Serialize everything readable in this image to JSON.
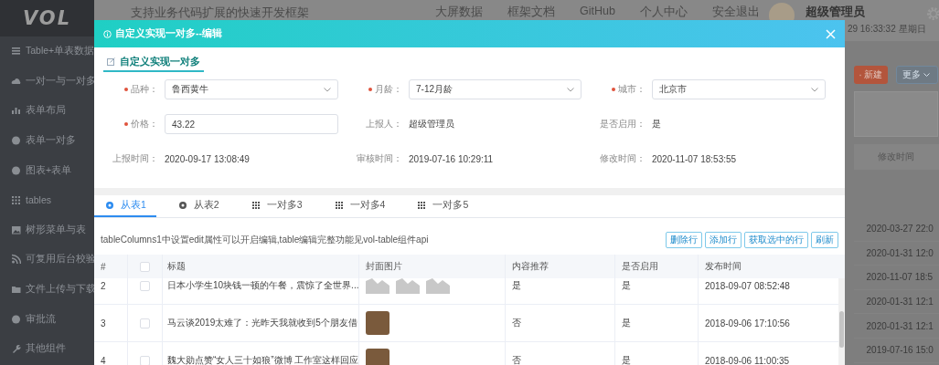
{
  "sidebar": {
    "logo": "VOL",
    "items": [
      "Table+单表数据",
      "一对一与一对多",
      "表单布局",
      "表单一对多",
      "图表+表单",
      "tables",
      "树形菜单与表",
      "可复用后台校验",
      "文件上传与下载",
      "审批流",
      "其他组件"
    ]
  },
  "header": {
    "title": "支持业务代码扩展的快速开发框架",
    "nav": [
      "大屏数据",
      "框架文档",
      "GitHub",
      "个人中心",
      "安全退出"
    ],
    "user_name": "超级管理员",
    "datetime": "29 16:33:32 星期日"
  },
  "background": {
    "buttons": [
      {
        "label": "新建",
        "kind": "primary"
      },
      {
        "label": "更多",
        "kind": "dropdown"
      }
    ],
    "table": {
      "column": "修改时间",
      "rows": [
        "2020-03-27 22:0",
        "2020-01-31 12:0",
        "2020-11-07 18:5",
        "2020-01-31 12:1",
        "2020-01-31 12:1",
        "2019-07-16 15:0"
      ]
    }
  },
  "modal": {
    "title": "自定义实现一对多--编辑",
    "section": "自定义实现一对多",
    "form": [
      [
        {
          "label": "品种：",
          "value": "鲁西黄牛",
          "required": true,
          "kind": "select"
        },
        {
          "label": "月龄：",
          "value": "7-12月龄",
          "required": true,
          "kind": "select"
        },
        {
          "label": "城市：",
          "value": "北京市",
          "required": true,
          "kind": "select"
        }
      ],
      [
        {
          "label": "价格：",
          "value": "43.22",
          "required": true,
          "kind": "input"
        },
        {
          "label": "上报人：",
          "value": "超级管理员",
          "required": false,
          "kind": "text"
        },
        {
          "label": "是否启用：",
          "value": "是",
          "required": false,
          "kind": "text"
        }
      ],
      [
        {
          "label": "上报时间：",
          "value": "2020-09-17 13:08:49",
          "required": false,
          "kind": "text"
        },
        {
          "label": "审核时间：",
          "value": "2019-07-16 10:29:11",
          "required": false,
          "kind": "text"
        },
        {
          "label": "修改时间：",
          "value": "2020-11-07 18:53:55",
          "required": false,
          "kind": "text"
        }
      ]
    ],
    "tabs": [
      {
        "label": "从表1",
        "selected": true
      },
      {
        "label": "从表2",
        "selected": false
      },
      {
        "label": "一对多3",
        "selected": false
      },
      {
        "label": "一对多4",
        "selected": false
      },
      {
        "label": "一对多5",
        "selected": false
      }
    ],
    "note": "tableColumns1中设置edit属性可以开启编辑,table编辑完整功能见vol-table组件api",
    "buttons": [
      "删除行",
      "添加行",
      "获取选中的行",
      "刷新"
    ],
    "table": {
      "columns": [
        "#",
        "标题",
        "封面图片",
        "内容推荐",
        "是否启用",
        "发布时间"
      ],
      "header_checked": false,
      "rows": [
        {
          "number": "2",
          "checked": false,
          "title": "日本小学生10块钱一顿的午餐，震惊了全世界...",
          "covers": [
            {
              "kind": "placeholder"
            },
            {
              "kind": "placeholder"
            },
            {
              "kind": "placeholder"
            }
          ],
          "recommended": "是",
          "enabled": "是",
          "published": "2018-09-07 08:52:48"
        },
        {
          "number": "3",
          "checked": false,
          "title": "马云谈2019太难了：光昨天我就收到5个朋友借",
          "covers": [
            {
              "kind": "photo"
            }
          ],
          "recommended": "否",
          "enabled": "是",
          "published": "2018-09-06 17:10:56"
        },
        {
          "number": "4",
          "checked": false,
          "title": "魏大勋点赞“女人三十如狼”微博 工作室这样回应",
          "covers": [
            {
              "kind": "photo"
            }
          ],
          "recommended": "否",
          "enabled": "是",
          "published": "2018-09-06 11:00:35"
        }
      ]
    }
  }
}
